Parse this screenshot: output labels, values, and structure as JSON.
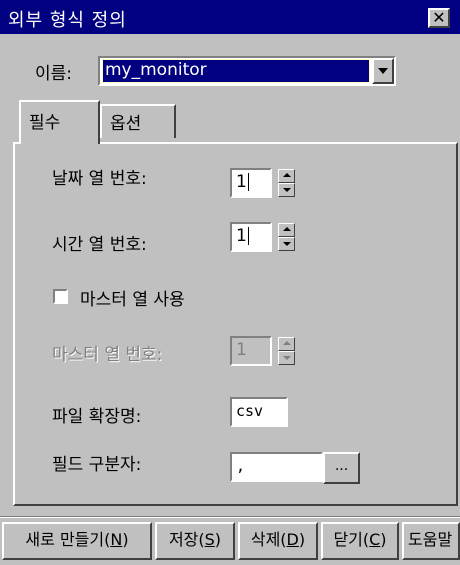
{
  "window": {
    "title": "외부 형식 정의",
    "close_glyph": "✕"
  },
  "name_field": {
    "label": "이름:",
    "value": "my_monitor"
  },
  "tabs": [
    {
      "label": "필수",
      "selected": true
    },
    {
      "label": "옵션",
      "selected": false
    }
  ],
  "fields": {
    "date_column": {
      "label": "날짜 열 번호:",
      "value": "1"
    },
    "time_column": {
      "label": "시간 열 번호:",
      "value": "1"
    },
    "use_master_column": {
      "label": "마스터 열 사용",
      "checked": false
    },
    "master_column": {
      "label": "마스터 열 번호:",
      "value": "1",
      "disabled": true
    },
    "file_extension": {
      "label": "파일 확장명:",
      "value": "csv"
    },
    "field_separator": {
      "label": "필드 구분자:",
      "value": ","
    }
  },
  "browse_button": {
    "label": "..."
  },
  "bottom_buttons": [
    {
      "text": "새로 만들기(",
      "key": "N",
      "close": ")"
    },
    {
      "text": "저장(",
      "key": "S",
      "close": ")"
    },
    {
      "text": "삭제(",
      "key": "D",
      "close": ")"
    },
    {
      "text": "닫기(",
      "key": "C",
      "close": ")"
    },
    {
      "text": "도움말",
      "key": "",
      "close": ""
    }
  ],
  "colors": {
    "face": "#c0c0c0",
    "titlebar": "#000080",
    "highlight": "#000080"
  },
  "icons": {
    "close": "close-icon",
    "dropdown": "chevron-down-icon",
    "spin_up": "spin-up-icon",
    "spin_down": "spin-down-icon"
  }
}
